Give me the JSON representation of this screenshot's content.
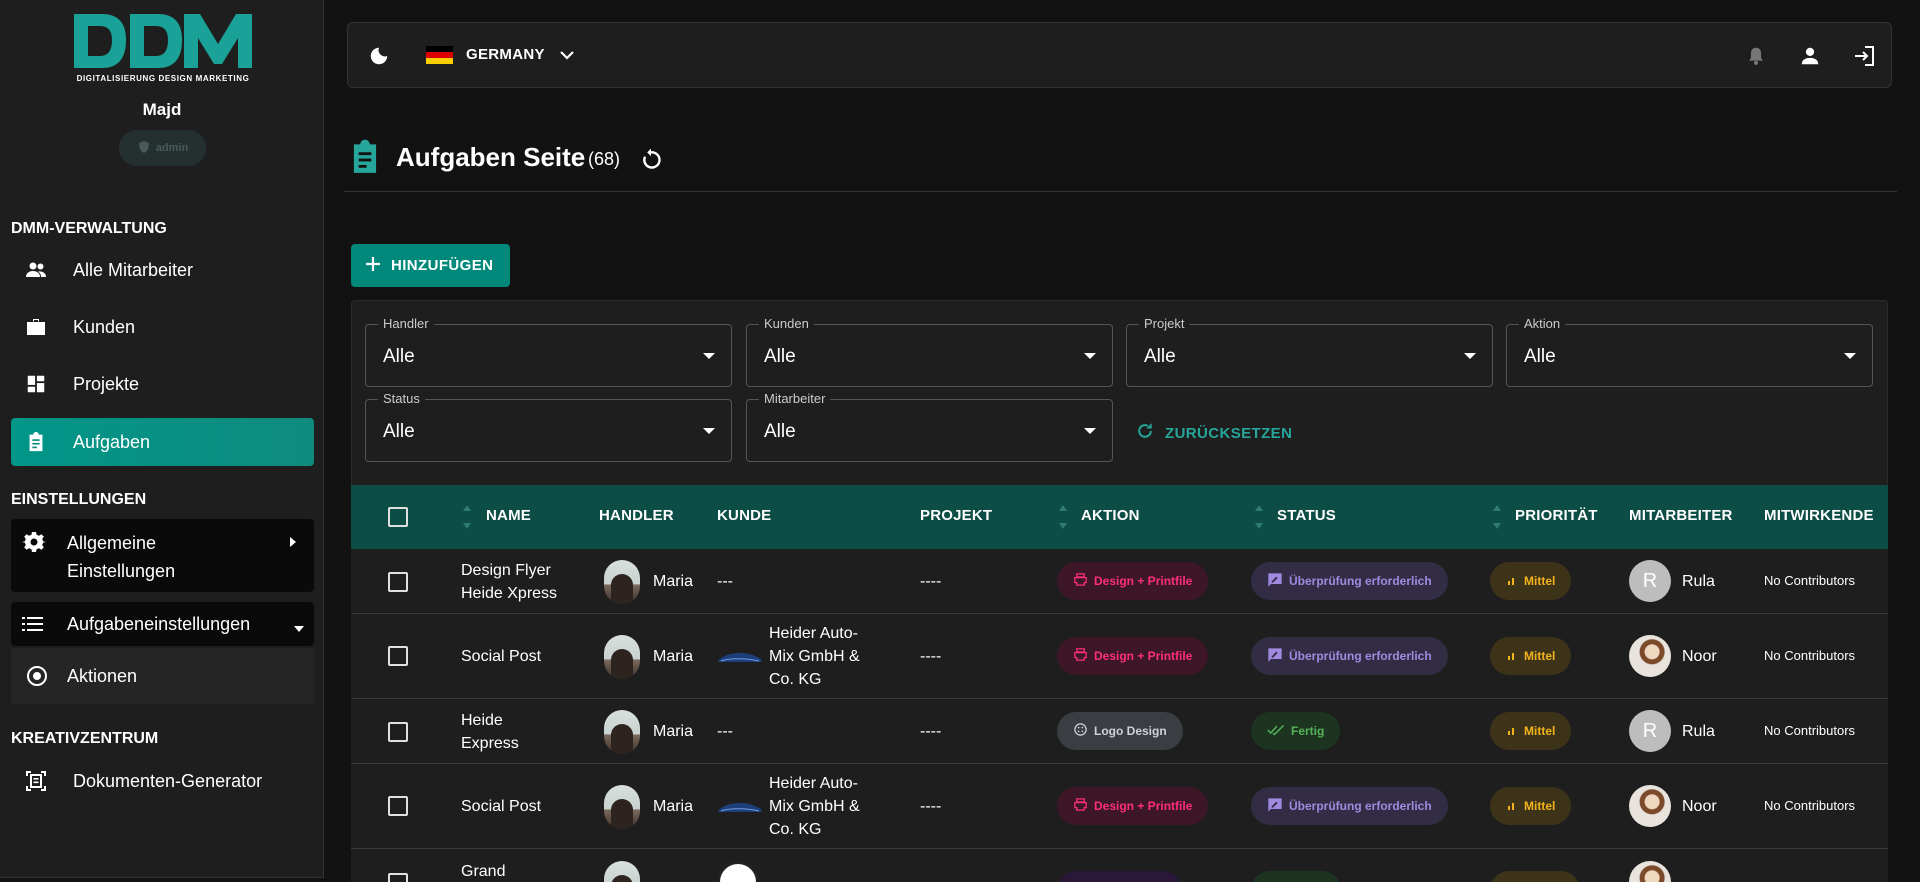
{
  "sidebar": {
    "logo_text": "DIGITALISIERUNG DESIGN MARKETING",
    "user_name": "Majd",
    "role": "admin",
    "sections": [
      {
        "title": "DMM-VERWALTUNG"
      },
      {
        "title": "EINSTELLUNGEN"
      },
      {
        "title": "KREATIVZENTRUM"
      }
    ],
    "items": [
      {
        "label": "Alle Mitarbeiter"
      },
      {
        "label": "Kunden"
      },
      {
        "label": "Projekte"
      },
      {
        "label": "Aufgaben"
      },
      {
        "label": "Allgemeine Einstellungen"
      },
      {
        "label": "Aufgabeneinstellungen"
      },
      {
        "label": "Aktionen"
      },
      {
        "label": "Dokumenten-Generator"
      }
    ]
  },
  "topbar": {
    "country": "GERMANY"
  },
  "header": {
    "title": "Aufgaben Seite",
    "count": "(68)",
    "add_label": "HINZUFÜGEN"
  },
  "filters": {
    "handler": {
      "label": "Handler",
      "value": "Alle"
    },
    "kunden": {
      "label": "Kunden",
      "value": "Alle"
    },
    "projekt": {
      "label": "Projekt",
      "value": "Alle"
    },
    "aktion": {
      "label": "Aktion",
      "value": "Alle"
    },
    "status": {
      "label": "Status",
      "value": "Alle"
    },
    "mitarbeiter": {
      "label": "Mitarbeiter",
      "value": "Alle"
    },
    "reset_label": "ZURÜCKSETZEN"
  },
  "table": {
    "columns": [
      "NAME",
      "HANDLER",
      "KUNDE",
      "PROJEKT",
      "AKTION",
      "STATUS",
      "PRIORITÄT",
      "MITARBEITER",
      "MITWIRKENDE"
    ],
    "rows": [
      {
        "name": "Design Flyer Heide Xpress",
        "handler": "Maria",
        "kunde": "---",
        "projekt": "----",
        "aktion": "Design + Printfile",
        "status": "Überprüfung erforderlich",
        "prioritaet": "Mittel",
        "mitarbeiter_initial": "R",
        "mitarbeiter": "Rula",
        "mitwirkende": "No Contributors"
      },
      {
        "name": "Social Post",
        "handler": "Maria",
        "kunde": "Heider Auto-Mix GmbH & Co. KG",
        "projekt": "----",
        "aktion": "Design + Printfile",
        "status": "Überprüfung erforderlich",
        "prioritaet": "Mittel",
        "mitarbeiter": "Noor",
        "mitwirkende": "No Contributors"
      },
      {
        "name": "Heide Express",
        "handler": "Maria",
        "kunde": "---",
        "projekt": "----",
        "aktion": "Logo Design",
        "status": "Fertig",
        "prioritaet": "Mittel",
        "mitarbeiter_initial": "R",
        "mitarbeiter": "Rula",
        "mitwirkende": "No Contributors"
      },
      {
        "name": "Social Post",
        "handler": "Maria",
        "kunde": "Heider Auto-Mix GmbH & Co. KG",
        "projekt": "----",
        "aktion": "Design + Printfile",
        "status": "Überprüfung erforderlich",
        "prioritaet": "Mittel",
        "mitarbeiter": "Noor",
        "mitwirkende": "No Contributors"
      },
      {
        "name": "Grand"
      }
    ]
  }
}
